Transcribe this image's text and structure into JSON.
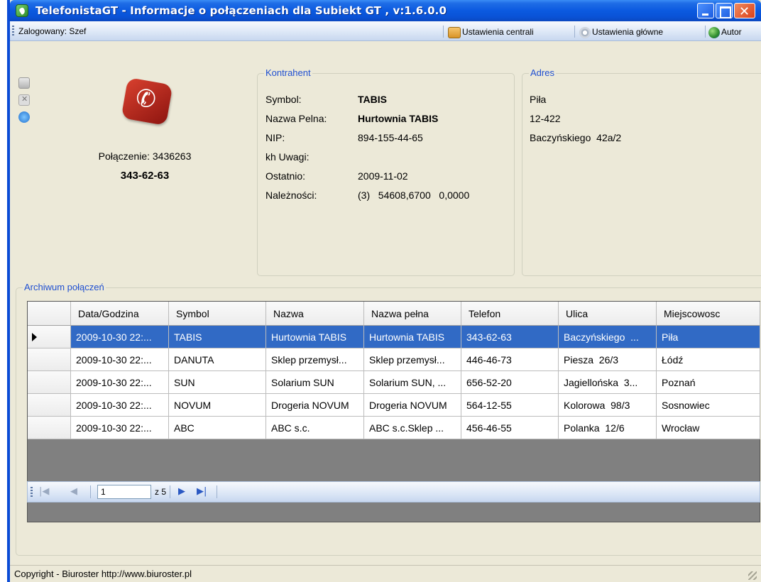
{
  "window": {
    "title": "TelefonistaGT - Informacje o połączeniach dla Subiekt GT , v:1.6.0.0"
  },
  "toolbar": {
    "logged_in": "Zalogowany: Szef",
    "central_settings": "Ustawienia centrali",
    "main_settings": "Ustawienia główne",
    "author": "Autor"
  },
  "call": {
    "connection_label": "Połączenie: 3436263",
    "phone_number": "343-62-63"
  },
  "contractor": {
    "title": "Kontrahent",
    "fields": [
      {
        "label": "Symbol:",
        "value": "TABIS",
        "bold": true
      },
      {
        "label": "Nazwa Pelna:",
        "value": "Hurtownia TABIS",
        "bold": true
      },
      {
        "label": "NIP:",
        "value": "894-155-44-65",
        "bold": false
      },
      {
        "label": "kh Uwagi:",
        "value": "",
        "bold": false
      },
      {
        "label": "Ostatnio:",
        "value": "2009-11-02",
        "bold": false
      },
      {
        "label": "Należności:",
        "value": "(3)   54608,6700   0,0000",
        "bold": false
      }
    ]
  },
  "address": {
    "title": "Adres",
    "lines": [
      "Piła",
      "12-422",
      "Baczyńskiego  42a/2"
    ]
  },
  "archive": {
    "title": "Archiwum połączeń",
    "columns": [
      "Data/Godzina",
      "Symbol",
      "Nazwa",
      "Nazwa pełna",
      "Telefon",
      "Ulica",
      "Miejscowosc"
    ],
    "rows": [
      [
        "2009-10-30 22:...",
        "TABIS",
        "Hurtownia TABIS",
        "Hurtownia TABIS",
        "343-62-63",
        "Baczyńskiego  ...",
        "Piła"
      ],
      [
        "2009-10-30 22:...",
        "DANUTA",
        "Sklep przemysł...",
        "Sklep przemysł...",
        "446-46-73",
        "Piesza  26/3",
        "Łódź"
      ],
      [
        "2009-10-30 22:...",
        "SUN",
        "Solarium SUN",
        "Solarium SUN, ...",
        "656-52-20",
        "Jagiellońska  3...",
        "Poznań"
      ],
      [
        "2009-10-30 22:...",
        "NOVUM",
        "Drogeria NOVUM",
        "Drogeria NOVUM",
        "564-12-55",
        "Kolorowa  98/3",
        "Sosnowiec"
      ],
      [
        "2009-10-30 22:...",
        "ABC",
        "ABC s.c.",
        "ABC s.c.Sklep ...",
        "456-46-55",
        "Polanka  12/6",
        "Wrocław"
      ]
    ],
    "selected_row": 0
  },
  "pager": {
    "current_page": "1",
    "of_label": "z 5"
  },
  "status": {
    "copyright": "Copyright - Biuroster http://www.biuroster.pl"
  },
  "colors": {
    "title_blue": "#0b5ae0",
    "selection": "#316ac5",
    "group_title": "#1f4fd1",
    "window_bg": "#ece9d8"
  }
}
